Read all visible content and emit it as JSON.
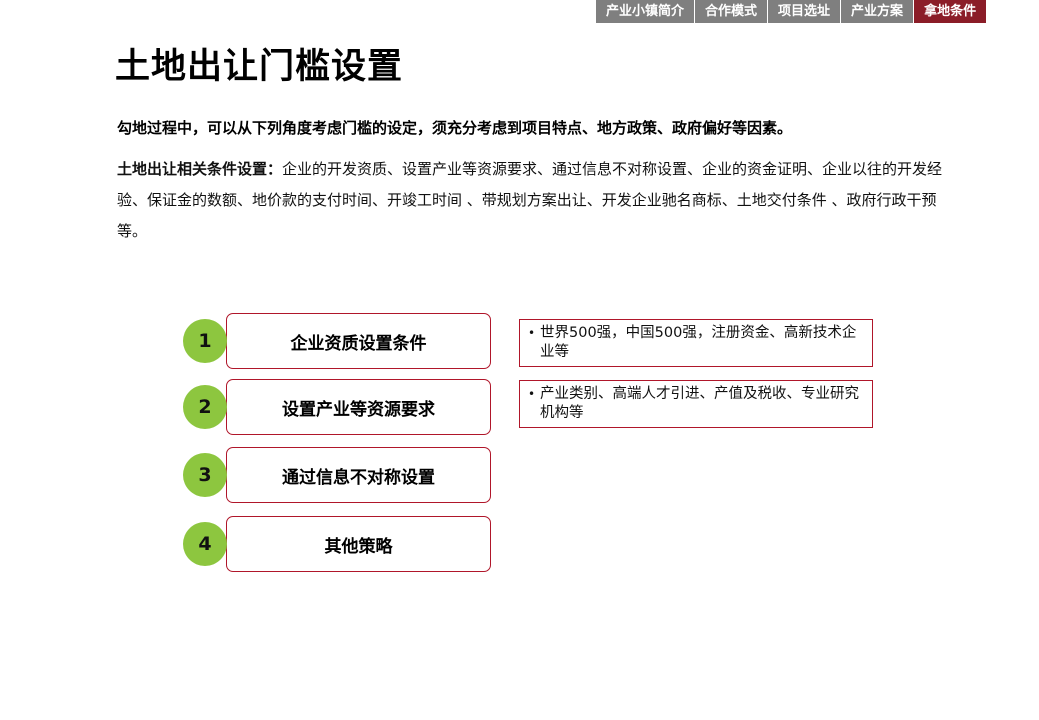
{
  "nav": {
    "items": [
      {
        "label": "产业小镇简介",
        "active": false
      },
      {
        "label": "合作模式",
        "active": false
      },
      {
        "label": "项目选址",
        "active": false
      },
      {
        "label": "产业方案",
        "active": false
      },
      {
        "label": "拿地条件",
        "active": true
      }
    ]
  },
  "title": "土地出让门槛设置",
  "intro": "勾地过程中，可以从下列角度考虑门槛的设定，须充分考虑到项目特点、地方政策、政府偏好等因素。",
  "conditions": {
    "lead": "土地出让相关条件设置：",
    "text": "企业的开发资质、设置产业等资源要求、通过信息不对称设置、企业的资金证明、企业以往的开发经验、保证金的数额、地价款的支付时间、开竣工时间 、带规划方案出让、开发企业驰名商标、土地交付条件 、政府行政干预等。"
  },
  "steps": [
    {
      "number": "1",
      "label": "企业资质设置条件"
    },
    {
      "number": "2",
      "label": "设置产业等资源要求"
    },
    {
      "number": "3",
      "label": "通过信息不对称设置"
    },
    {
      "number": "4",
      "label": "其他策略"
    }
  ],
  "notes": [
    {
      "bullet": "•",
      "text": "世界500强，中国500强，注册资金、高新技术企业等"
    },
    {
      "bullet": "•",
      "text": "产业类别、高端人才引进、产值及税收、专业研究机构等"
    }
  ],
  "colors": {
    "nav_bg": "#7f7f7f",
    "nav_active": "#8b1d28",
    "accent_border": "#b0162a",
    "number_circle": "#8dc63f"
  }
}
